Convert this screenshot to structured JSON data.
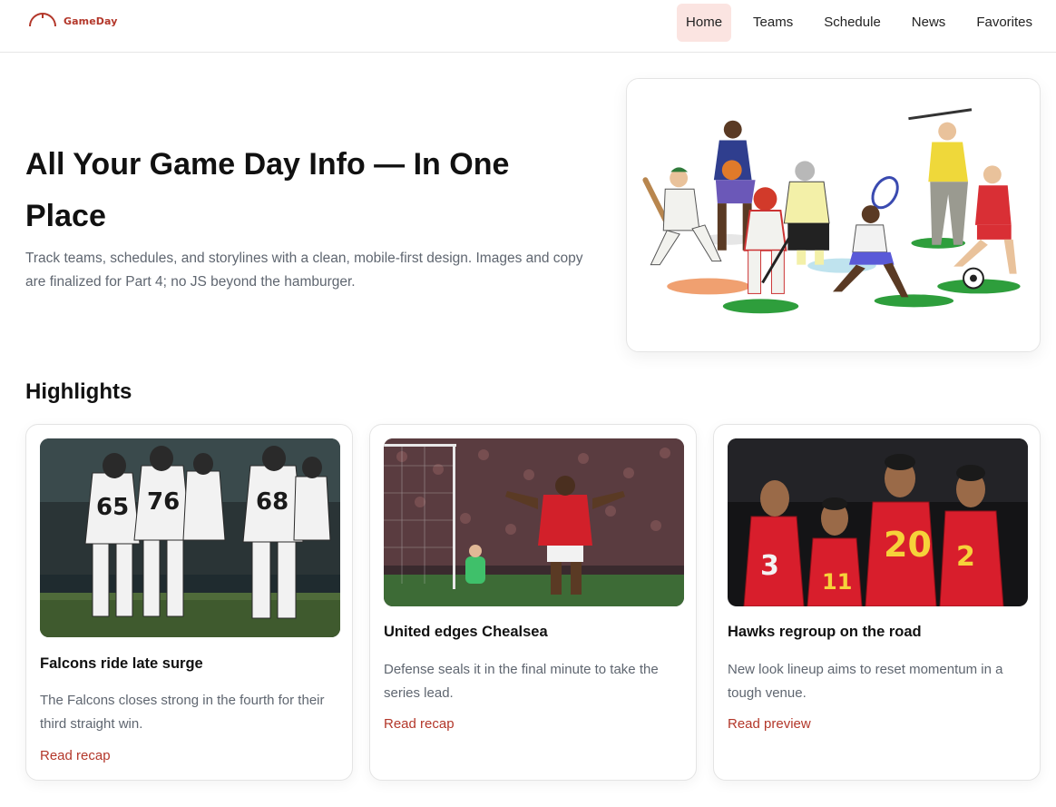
{
  "header": {
    "brand": "GameDay",
    "brand_icon": "gauge-arc-icon",
    "nav": [
      {
        "label": "Home",
        "active": true
      },
      {
        "label": "Teams",
        "active": false
      },
      {
        "label": "Schedule",
        "active": false
      },
      {
        "label": "News",
        "active": false
      },
      {
        "label": "Favorites",
        "active": false
      }
    ]
  },
  "hero": {
    "title": "All Your Game Day Info — In One Place",
    "subtitle": "Track teams, schedules, and storylines with a clean, mobile-first design. Images and copy are finalized for Part 4; no JS beyond the hamburger.",
    "image_subject": "illustrated athletes from multiple sports"
  },
  "highlights": {
    "title": "Highlights",
    "cards": [
      {
        "title": "Falcons ride late surge",
        "text": "The Falcons closes strong in the fourth for their third straight win.",
        "link": "Read recap",
        "jersey_numbers": [
          "65",
          "76",
          "68"
        ]
      },
      {
        "title": "United edges Chealsea",
        "text": "Defense seals it in the final minute to take the series lead.",
        "link": "Read recap"
      },
      {
        "title": "Hawks regroup on the road",
        "text": "New look lineup aims to reset momentum in a tough venue.",
        "link": "Read preview",
        "jersey_numbers": [
          "3",
          "11",
          "20",
          "2"
        ]
      }
    ]
  },
  "colors": {
    "accent": "#b3372a",
    "active_nav_bg": "#fbe4e1",
    "muted_text": "#5f6670",
    "falcons_white": "#f2f2f2",
    "united_red": "#d2202a",
    "hawks_red": "#d81e2c"
  }
}
